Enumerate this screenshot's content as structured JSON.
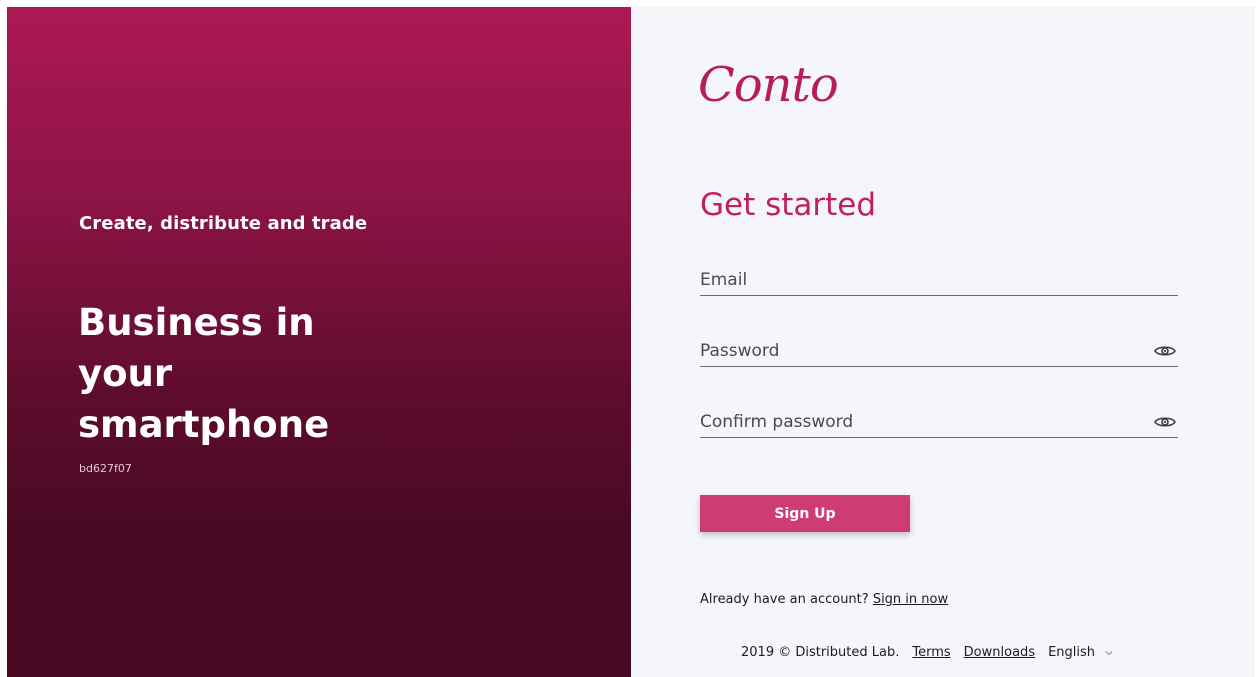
{
  "hero": {
    "tagline": "Create, distribute and trade",
    "title": "Business in\nyour\nsmartphone",
    "version": "bd627f07"
  },
  "brand": {
    "logo_text": "Conto",
    "accent_color": "#c21f60"
  },
  "form": {
    "heading": "Get started",
    "email_label": "Email",
    "password_label": "Password",
    "confirm_password_label": "Confirm password",
    "toggle_icon": "eye-icon",
    "submit_label": "Sign Up"
  },
  "signin": {
    "prompt": "Already have an account?",
    "link_label": "Sign in now"
  },
  "footer": {
    "copyright": "2019 © Distributed Lab.",
    "terms_label": "Terms",
    "downloads_label": "Downloads",
    "language": "English"
  }
}
